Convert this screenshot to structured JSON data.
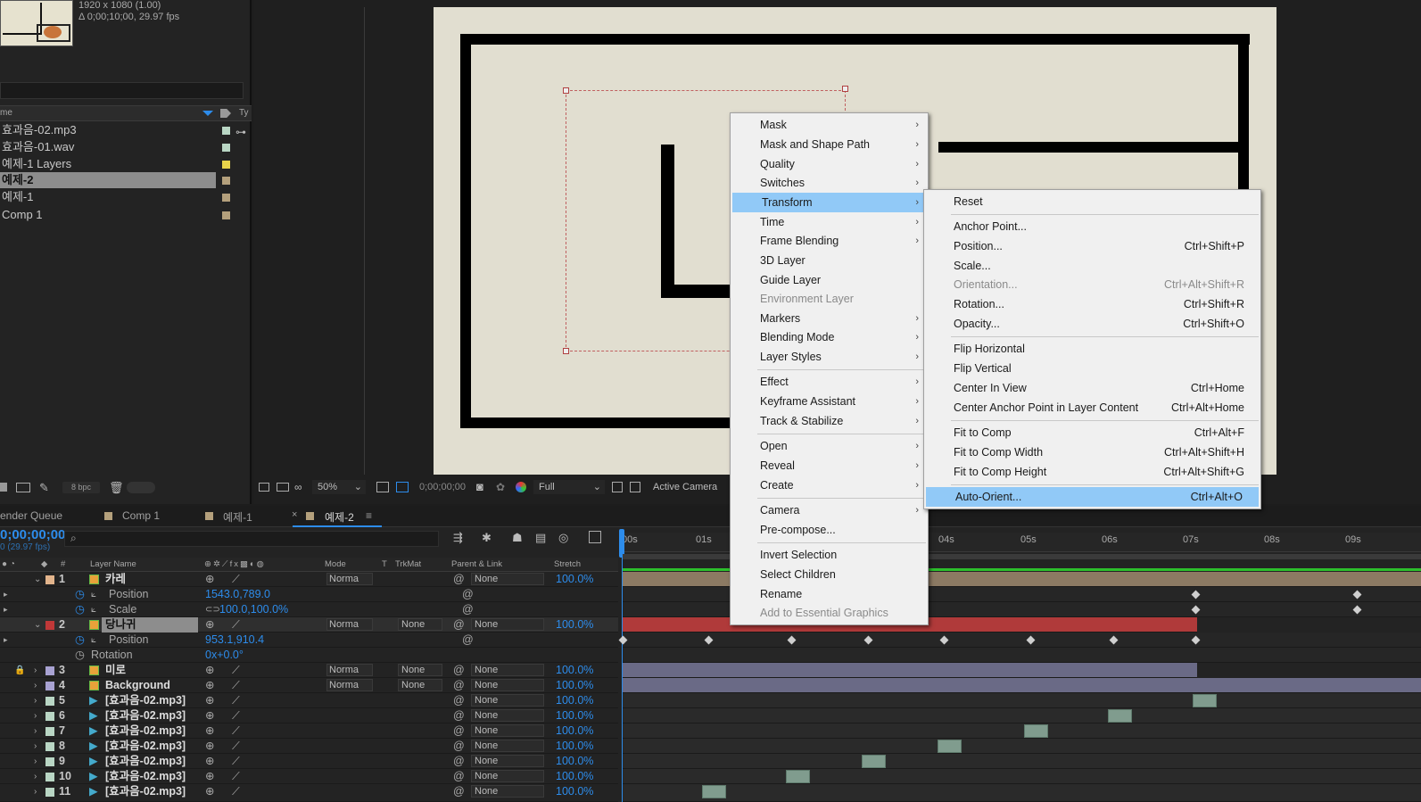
{
  "project": {
    "info_line1": "1920 x 1080 (1.00)",
    "info_line2": "Δ 0;00;10;00, 29.97 fps",
    "col_name": "me",
    "col_type": "Ty",
    "items": [
      {
        "label": "효과음-02.mp3",
        "color": "#b9d6c4",
        "selected": false
      },
      {
        "label": "효과음-01.wav",
        "color": "#b9d6c4",
        "selected": false
      },
      {
        "label": "예제-1 Layers",
        "color": "#e8d34a",
        "selected": false
      },
      {
        "label": "예제-2",
        "color": "#b4a07c",
        "selected": true
      },
      {
        "label": "예제-1",
        "color": "#b4a07c",
        "selected": false
      },
      {
        "label": "Comp 1",
        "color": "#b4a07c",
        "selected": false
      }
    ],
    "bpc": "8 bpc"
  },
  "viewer": {
    "zoom": "50%",
    "timecode": "0;00;00;00",
    "resolution": "Full",
    "camera": "Active Camera"
  },
  "context_menu": {
    "items": [
      {
        "label": "Mask",
        "submenu": true,
        "disabled": false,
        "selected": false
      },
      {
        "label": "Mask and Shape Path",
        "submenu": true,
        "disabled": false,
        "selected": false
      },
      {
        "label": "Quality",
        "submenu": true,
        "disabled": false,
        "selected": false
      },
      {
        "label": "Switches",
        "submenu": true,
        "disabled": false,
        "selected": false
      },
      {
        "label": "Transform",
        "submenu": true,
        "disabled": false,
        "selected": true
      },
      {
        "label": "Time",
        "submenu": true,
        "disabled": false,
        "selected": false
      },
      {
        "label": "Frame Blending",
        "submenu": true,
        "disabled": false,
        "selected": false
      },
      {
        "label": "3D Layer",
        "submenu": false,
        "disabled": false,
        "selected": false
      },
      {
        "label": "Guide Layer",
        "submenu": false,
        "disabled": false,
        "selected": false
      },
      {
        "label": "Environment Layer",
        "submenu": false,
        "disabled": true,
        "selected": false
      },
      {
        "label": "Markers",
        "submenu": true,
        "disabled": false,
        "selected": false
      },
      {
        "label": "Blending Mode",
        "submenu": true,
        "disabled": false,
        "selected": false
      },
      {
        "label": "Layer Styles",
        "submenu": true,
        "disabled": false,
        "selected": false
      },
      {
        "label": "Effect",
        "submenu": true,
        "disabled": false,
        "selected": false
      },
      {
        "label": "Keyframe Assistant",
        "submenu": true,
        "disabled": false,
        "selected": false
      },
      {
        "label": "Track & Stabilize",
        "submenu": true,
        "disabled": false,
        "selected": false
      },
      {
        "label": "Open",
        "submenu": true,
        "disabled": false,
        "selected": false
      },
      {
        "label": "Reveal",
        "submenu": true,
        "disabled": false,
        "selected": false
      },
      {
        "label": "Create",
        "submenu": true,
        "disabled": false,
        "selected": false
      },
      {
        "label": "Camera",
        "submenu": true,
        "disabled": false,
        "selected": false
      },
      {
        "label": "Pre-compose...",
        "submenu": false,
        "disabled": false,
        "selected": false
      },
      {
        "label": "Invert Selection",
        "submenu": false,
        "disabled": false,
        "selected": false
      },
      {
        "label": "Select Children",
        "submenu": false,
        "disabled": false,
        "selected": false
      },
      {
        "label": "Rename",
        "submenu": false,
        "disabled": false,
        "selected": false
      },
      {
        "label": "Add to Essential Graphics",
        "submenu": false,
        "disabled": true,
        "selected": false
      }
    ]
  },
  "transform_submenu": {
    "items": [
      {
        "label": "Reset",
        "shortcut": "",
        "disabled": false,
        "selected": false
      },
      {
        "label": "Anchor Point...",
        "shortcut": "",
        "disabled": false,
        "selected": false
      },
      {
        "label": "Position...",
        "shortcut": "Ctrl+Shift+P",
        "disabled": false,
        "selected": false
      },
      {
        "label": "Scale...",
        "shortcut": "",
        "disabled": false,
        "selected": false
      },
      {
        "label": "Orientation...",
        "shortcut": "Ctrl+Alt+Shift+R",
        "disabled": true,
        "selected": false
      },
      {
        "label": "Rotation...",
        "shortcut": "Ctrl+Shift+R",
        "disabled": false,
        "selected": false
      },
      {
        "label": "Opacity...",
        "shortcut": "Ctrl+Shift+O",
        "disabled": false,
        "selected": false
      },
      {
        "label": "Flip Horizontal",
        "shortcut": "",
        "disabled": false,
        "selected": false
      },
      {
        "label": "Flip Vertical",
        "shortcut": "",
        "disabled": false,
        "selected": false
      },
      {
        "label": "Center In View",
        "shortcut": "Ctrl+Home",
        "disabled": false,
        "selected": false
      },
      {
        "label": "Center Anchor Point in Layer Content",
        "shortcut": "Ctrl+Alt+Home",
        "disabled": false,
        "selected": false
      },
      {
        "label": "Fit to Comp",
        "shortcut": "Ctrl+Alt+F",
        "disabled": false,
        "selected": false
      },
      {
        "label": "Fit to Comp Width",
        "shortcut": "Ctrl+Alt+Shift+H",
        "disabled": false,
        "selected": false
      },
      {
        "label": "Fit to Comp Height",
        "shortcut": "Ctrl+Alt+Shift+G",
        "disabled": false,
        "selected": false
      },
      {
        "label": "Auto-Orient...",
        "shortcut": "Ctrl+Alt+O",
        "disabled": false,
        "selected": true
      }
    ]
  },
  "timeline": {
    "tabs": {
      "render_queue": "ender Queue",
      "comp1": "Comp 1",
      "ex1": "예제-1",
      "ex2": "예제-2"
    },
    "timecode": "0;00;00;00",
    "fps": "0 (29.97 fps)",
    "headers": {
      "layer_name": "Layer Name",
      "mode": "Mode",
      "t": "T",
      "trkmat": "TrkMat",
      "parent": "Parent & Link",
      "stretch": "Stretch"
    },
    "ruler": [
      "00s",
      "01s",
      "04s",
      "05s",
      "06s",
      "07s",
      "08s",
      "09s"
    ],
    "rows": {
      "r1": {
        "num": "1",
        "name": "카레",
        "mode": "Norma",
        "parent": "None",
        "stretch": "100.0%"
      },
      "r1_pos": {
        "label": "Position",
        "value": "1543.0,789.0"
      },
      "r1_scale": {
        "label": "Scale",
        "value": "100.0,100.0%"
      },
      "r2": {
        "num": "2",
        "name": "당나귀",
        "mode": "Norma",
        "trkmat": "None",
        "parent": "None",
        "stretch": "100.0%"
      },
      "r2_pos": {
        "label": "Position",
        "value": "953.1,910.4"
      },
      "r2_rot": {
        "label": "Rotation",
        "value": "0x+0.0°"
      },
      "r3": {
        "num": "3",
        "name": "미로",
        "mode": "Norma",
        "trkmat": "None",
        "parent": "None",
        "stretch": "100.0%"
      },
      "r4": {
        "num": "4",
        "name": "Background",
        "mode": "Norma",
        "trkmat": "None",
        "parent": "None",
        "stretch": "100.0%"
      },
      "r5": {
        "num": "5",
        "name": "[효과음-02.mp3]",
        "parent": "None",
        "stretch": "100.0%"
      },
      "r6": {
        "num": "6",
        "name": "[효과음-02.mp3]",
        "parent": "None",
        "stretch": "100.0%"
      },
      "r7": {
        "num": "7",
        "name": "[효과음-02.mp3]",
        "parent": "None",
        "stretch": "100.0%"
      },
      "r8": {
        "num": "8",
        "name": "[효과음-02.mp3]",
        "parent": "None",
        "stretch": "100.0%"
      },
      "r9": {
        "num": "9",
        "name": "[효과음-02.mp3]",
        "parent": "None",
        "stretch": "100.0%"
      },
      "r10": {
        "num": "10",
        "name": "[효과음-02.mp3]",
        "parent": "None",
        "stretch": "100.0%"
      },
      "r11": {
        "num": "11",
        "name": "[효과음-02.mp3]",
        "parent": "None",
        "stretch": "100.0%"
      }
    }
  },
  "colors": {
    "accent_blue": "#2d8ceb",
    "menu_highlight": "#91c9f7",
    "layer1_bar": "#8c7a63",
    "layer2_bar": "#b03a3a",
    "layer3_bar": "#6a6a86",
    "audio_clip": "#809c8e"
  }
}
